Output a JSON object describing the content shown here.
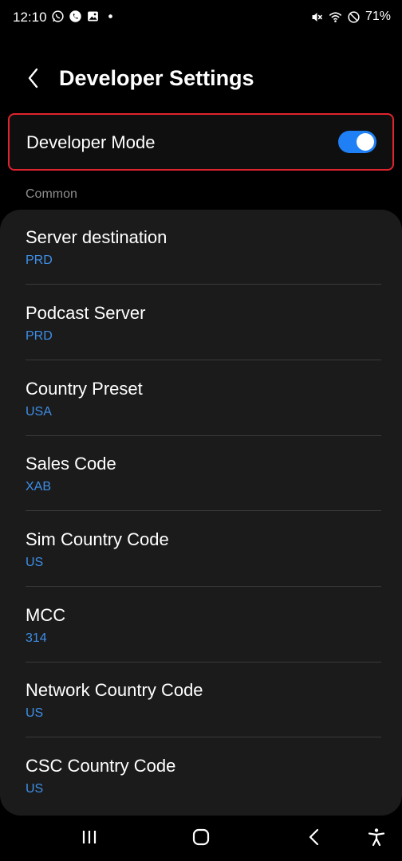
{
  "status_bar": {
    "time": "12:10",
    "battery": "71%",
    "left_icons": [
      "whatsapp-icon",
      "whatsapp-call-icon",
      "gallery-icon",
      "dot-icon"
    ],
    "right_icons": [
      "mute-icon",
      "wifi-icon",
      "dnd-icon"
    ]
  },
  "header": {
    "title": "Developer Settings"
  },
  "developer_mode": {
    "label": "Developer Mode",
    "enabled": true
  },
  "section": {
    "label": "Common"
  },
  "items": [
    {
      "title": "Server destination",
      "value": "PRD"
    },
    {
      "title": "Podcast Server",
      "value": "PRD"
    },
    {
      "title": "Country Preset",
      "value": "USA"
    },
    {
      "title": "Sales Code",
      "value": "XAB"
    },
    {
      "title": "Sim Country Code",
      "value": "US"
    },
    {
      "title": "MCC",
      "value": "314"
    },
    {
      "title": "Network Country Code",
      "value": "US"
    },
    {
      "title": "CSC Country Code",
      "value": "US"
    }
  ],
  "colors": {
    "accent": "#3d8fe8",
    "toggle_on": "#1f80f5",
    "highlight_border": "#e0242f",
    "card_bg": "#1b1b1b"
  },
  "nav_bar": [
    "recents-icon",
    "home-icon",
    "back-icon",
    "accessibility-icon"
  ]
}
